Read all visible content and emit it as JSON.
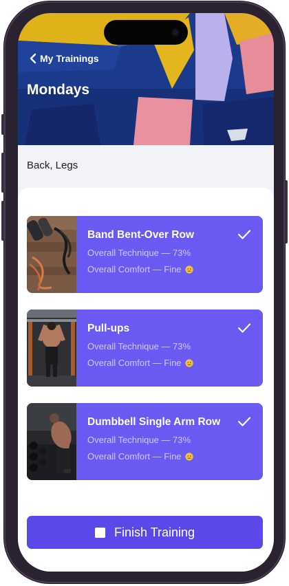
{
  "colors": {
    "accent": "#6b5af2",
    "button": "#5a49e8",
    "card_subtext": "#cfc9ff",
    "tags_background": "#f1f3f6"
  },
  "header": {
    "back_icon": "chevron-left-icon",
    "back_label": "My Trainings",
    "title": "Mondays"
  },
  "tags": "Back, Legs",
  "exercises": [
    {
      "name": "Band Bent-Over Row",
      "technique": "Overall Technique — 73%",
      "comfort": "Overall Comfort — Fine",
      "comfort_icon": "neutral-face-emoji",
      "status_icon": "checkmark-icon",
      "image": "resistance-bands-and-dumbbells-photo"
    },
    {
      "name": "Pull-ups",
      "technique": "Overall Technique — 73%",
      "comfort": "Overall Comfort — Fine",
      "comfort_icon": "neutral-face-emoji",
      "status_icon": "checkmark-icon",
      "image": "pull-up-athlete-photo"
    },
    {
      "name": "Dumbbell Single Arm Row",
      "technique": "Overall Technique — 73%",
      "comfort": "Overall Comfort — Fine",
      "comfort_icon": "neutral-face-emoji",
      "status_icon": "checkmark-icon",
      "image": "dumbbell-rack-athlete-photo"
    }
  ],
  "finish": {
    "icon": "checkbox-icon",
    "label": "Finish Training"
  }
}
